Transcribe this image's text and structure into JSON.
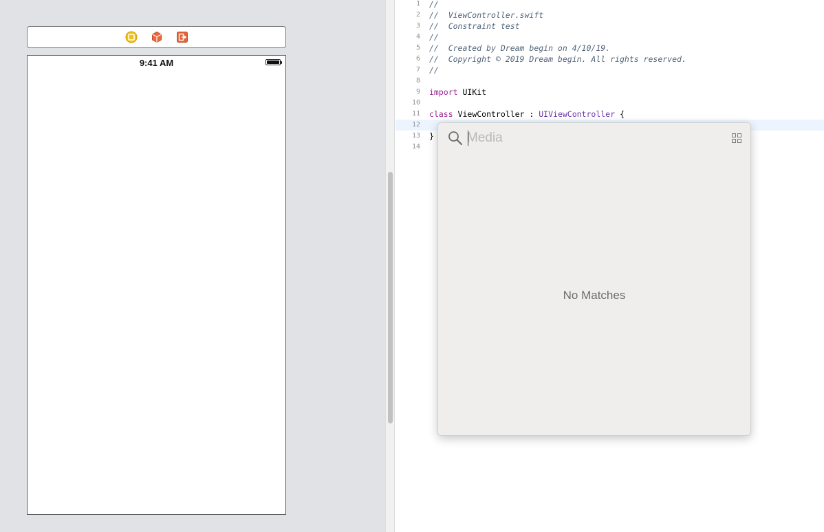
{
  "storyboard": {
    "status_time": "9:41 AM",
    "dock_icons": [
      "view-controller-icon",
      "first-responder-icon",
      "exit-icon"
    ]
  },
  "editor": {
    "current_line": 12,
    "lines": [
      {
        "num": "1",
        "tokens": [
          {
            "t": "//",
            "c": "comment"
          }
        ]
      },
      {
        "num": "2",
        "tokens": [
          {
            "t": "//  ViewController.swift",
            "c": "comment"
          }
        ]
      },
      {
        "num": "3",
        "tokens": [
          {
            "t": "//  Constraint test",
            "c": "comment"
          }
        ]
      },
      {
        "num": "4",
        "tokens": [
          {
            "t": "//",
            "c": "comment"
          }
        ]
      },
      {
        "num": "5",
        "tokens": [
          {
            "t": "//  Created by Dream begin on 4/10/19.",
            "c": "comment"
          }
        ]
      },
      {
        "num": "6",
        "tokens": [
          {
            "t": "//  Copyright © 2019 Dream begin. All rights reserved.",
            "c": "comment"
          }
        ]
      },
      {
        "num": "7",
        "tokens": [
          {
            "t": "//",
            "c": "comment"
          }
        ]
      },
      {
        "num": "8",
        "tokens": []
      },
      {
        "num": "9",
        "tokens": [
          {
            "t": "import",
            "c": "keyword"
          },
          {
            "t": " UIKit",
            "c": "plain"
          }
        ]
      },
      {
        "num": "10",
        "tokens": []
      },
      {
        "num": "11",
        "tokens": [
          {
            "t": "class",
            "c": "keyword"
          },
          {
            "t": " ViewController : ",
            "c": "plain"
          },
          {
            "t": "UIViewController",
            "c": "type"
          },
          {
            "t": " {",
            "c": "plain"
          }
        ]
      },
      {
        "num": "12",
        "tokens": []
      },
      {
        "num": "13",
        "tokens": [
          {
            "t": "}",
            "c": "plain"
          }
        ]
      },
      {
        "num": "14",
        "tokens": []
      }
    ]
  },
  "media_popover": {
    "search_placeholder": "Media",
    "search_value": "",
    "empty_message": "No Matches"
  },
  "colors": {
    "canvas_bg": "#e1e2e5",
    "comment": "#536579",
    "keyword": "#9b2393",
    "type": "#6c36a9",
    "current_line_bg": "#ecf5ff"
  }
}
